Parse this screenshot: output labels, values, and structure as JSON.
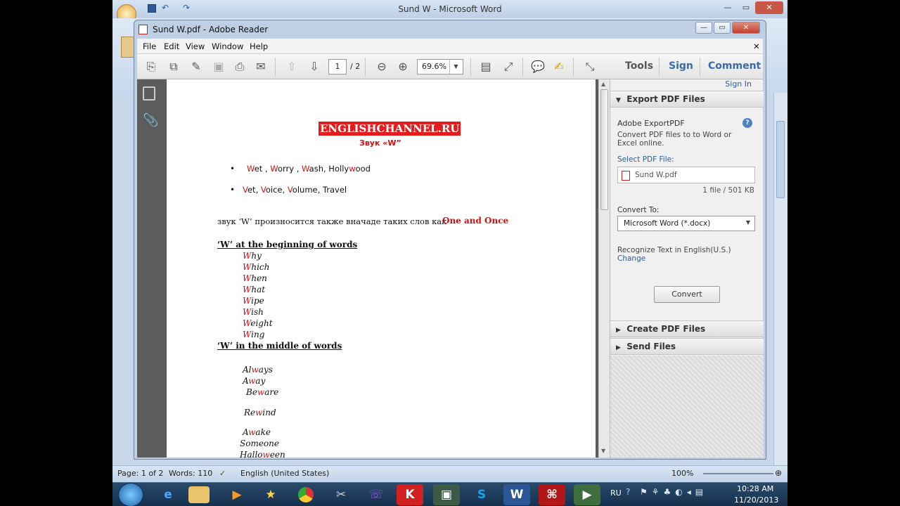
{
  "word": {
    "title": "Sund W - Microsoft Word",
    "status_page": "Page: 1 of 2",
    "status_words": "Words: 110",
    "status_lang": "English (United States)",
    "status_zoom": "100%"
  },
  "reader": {
    "title": "Sund W.pdf - Adobe Reader",
    "menu": [
      "File",
      "Edit",
      "View",
      "Window",
      "Help"
    ],
    "page_current": "1",
    "page_total": "/ 2",
    "zoom": "69.6%",
    "tab_tools": "Tools",
    "tab_sign": "Sign",
    "tab_comment": "Comment"
  },
  "pane": {
    "sign_in": "Sign In",
    "export_header": "Export PDF Files",
    "export_title": "Adobe ExportPDF",
    "export_desc": "Convert PDF files to to Word or Excel online.",
    "select_label": "Select PDF File:",
    "file_name": "Sund W.pdf",
    "file_count": "1 file / 501 KB",
    "convert_to_label": "Convert To:",
    "convert_option": "Microsoft Word (*.docx)",
    "recognize": "Recognize Text in English(U.S.)",
    "change": "Change",
    "convert_button": "Convert",
    "create_header": "Create PDF Files",
    "send_header": "Send Files"
  },
  "doc": {
    "brand": "ENGLISHCHANNEL.RU",
    "subtitle": "Звук «W”",
    "bullet1": "Wet , Worry , Wash, Hollywood",
    "bullet2": "Vet, Voice, Volume, Travel",
    "note_ru": "звук ‘W’ произносится также вначаде таких слов как",
    "note_en": "One and Once",
    "heading1": "‘W’ at the beginning of words",
    "words_begin": [
      "Why",
      "Which",
      "When",
      "What",
      "Wipe",
      "Wish",
      "Weight",
      "Wing"
    ],
    "heading2": "‘W’ in the middle of words",
    "words_middle": [
      "Always",
      "Away",
      "Beware",
      "Rewind",
      "Awake",
      "Someone",
      "Halloween"
    ]
  },
  "taskbar": {
    "lang": "RU",
    "time": "10:28 AM",
    "date": "11/20/2013"
  }
}
